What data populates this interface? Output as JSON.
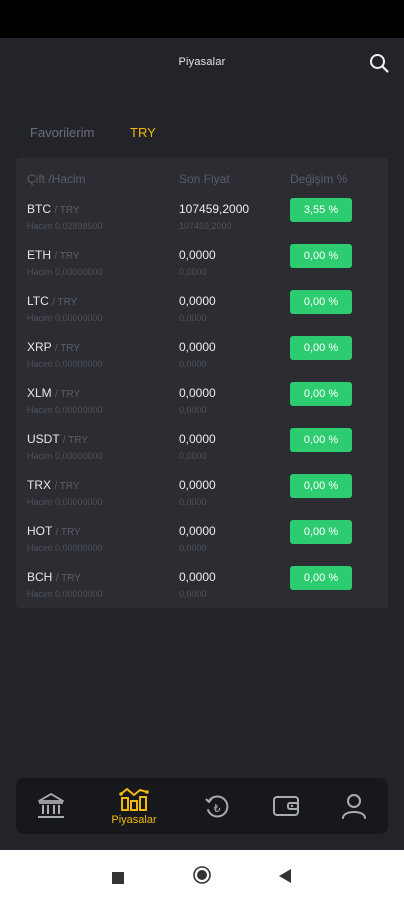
{
  "header": {
    "title": "Piyasalar"
  },
  "tabs": {
    "favorites": "Favorilerim",
    "try": "TRY"
  },
  "table": {
    "columns": {
      "pair": "Çift /Hacim",
      "price": "Son Fiyat",
      "change": "Değişim %"
    },
    "rows": [
      {
        "base": "BTC",
        "quote": "/ TRY",
        "volume": "Hacim 0,02898500",
        "price": "107459,2000",
        "price_sub": "107459,2000",
        "change": "3,55 %"
      },
      {
        "base": "ETH",
        "quote": "/ TRY",
        "volume": "Hacim 0,00000000",
        "price": "0,0000",
        "price_sub": "0,0000",
        "change": "0,00 %"
      },
      {
        "base": "LTC",
        "quote": "/ TRY",
        "volume": "Hacim 0,00000000",
        "price": "0,0000",
        "price_sub": "0,0000",
        "change": "0,00 %"
      },
      {
        "base": "XRP",
        "quote": "/ TRY",
        "volume": "Hacim 0,00000000",
        "price": "0,0000",
        "price_sub": "0,0000",
        "change": "0,00 %"
      },
      {
        "base": "XLM",
        "quote": "/ TRY",
        "volume": "Hacim 0,00000000",
        "price": "0,0000",
        "price_sub": "0,0000",
        "change": "0,00 %"
      },
      {
        "base": "USDT",
        "quote": "/ TRY",
        "volume": "Hacim 0,00000000",
        "price": "0,0000",
        "price_sub": "0,0000",
        "change": "0,00 %"
      },
      {
        "base": "TRX",
        "quote": "/ TRY",
        "volume": "Hacim 0,00000000",
        "price": "0,0000",
        "price_sub": "0,0000",
        "change": "0,00 %"
      },
      {
        "base": "HOT",
        "quote": "/ TRY",
        "volume": "Hacim 0,00000000",
        "price": "0,0000",
        "price_sub": "0,0000",
        "change": "0,00 %"
      },
      {
        "base": "BCH",
        "quote": "/ TRY",
        "volume": "Hacim 0,00000000",
        "price": "0,0000",
        "price_sub": "0,0000",
        "change": "0,00 %"
      }
    ]
  },
  "bottom_nav": {
    "items": [
      {
        "icon": "bank-icon"
      },
      {
        "icon": "markets-icon",
        "label": "Piyasalar"
      },
      {
        "icon": "history-icon"
      },
      {
        "icon": "wallet-icon"
      },
      {
        "icon": "user-icon"
      }
    ]
  },
  "colors": {
    "accent": "#f0b90b",
    "positive": "#2ecc71",
    "background": "#222429",
    "card": "#2b2d32"
  }
}
